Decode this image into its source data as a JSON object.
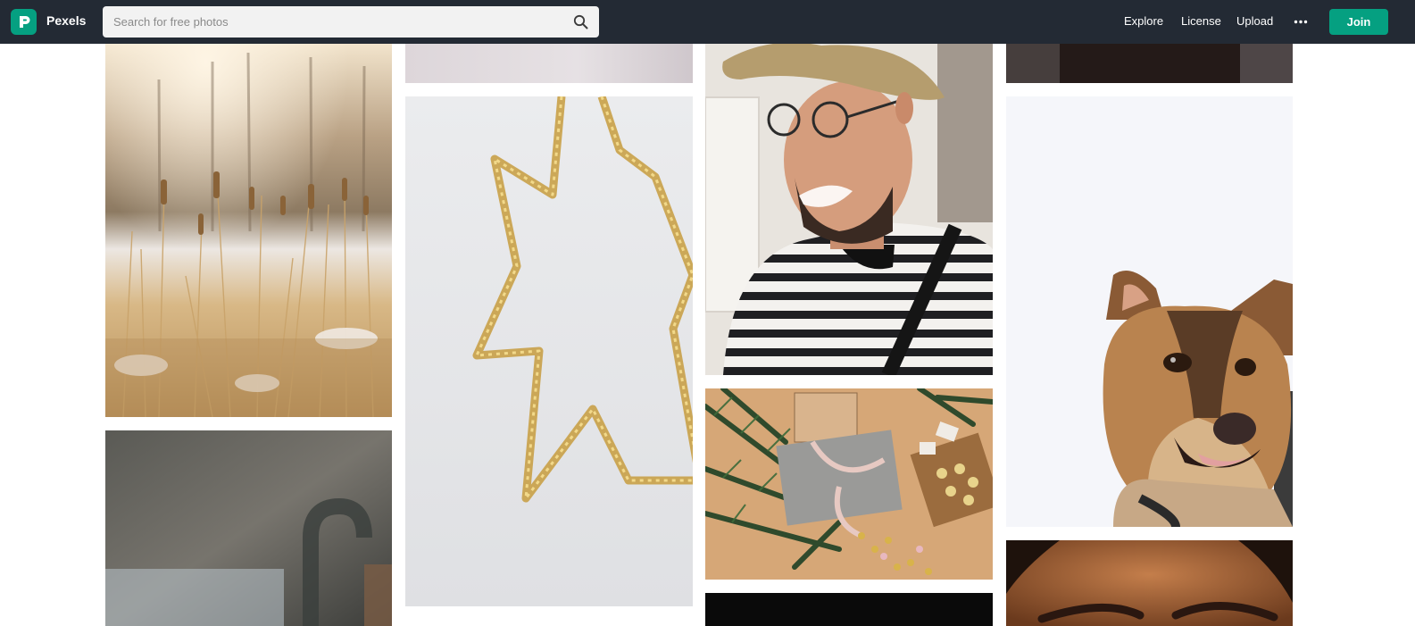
{
  "header": {
    "brand": "Pexels",
    "logo_icon": "pexels-logo-icon",
    "search": {
      "placeholder": "Search for free photos",
      "value": "",
      "icon": "search-icon"
    },
    "nav": [
      {
        "label": "Explore"
      },
      {
        "label": "License"
      },
      {
        "label": "Upload"
      }
    ],
    "more_icon": "more-horizontal-icon",
    "join_label": "Join",
    "colors": {
      "bar": "#232a34",
      "accent": "#05a081"
    }
  },
  "gallery": {
    "photos": [
      {
        "subject": "cattails-in-snowy-field"
      },
      {
        "subject": "blurred-kitchen-faucet"
      },
      {
        "subject": "top-crop-pale-photo"
      },
      {
        "subject": "gold-glitter-star-ornament"
      },
      {
        "subject": "smiling-man-in-cap-striped-shirt"
      },
      {
        "subject": "christmas-gifts-and-ornaments-flatlay"
      },
      {
        "subject": "dark-photo"
      },
      {
        "subject": "top-crop-dark-photo"
      },
      {
        "subject": "dog-on-white-background"
      },
      {
        "subject": "close-up-face-eyebrows"
      }
    ]
  }
}
